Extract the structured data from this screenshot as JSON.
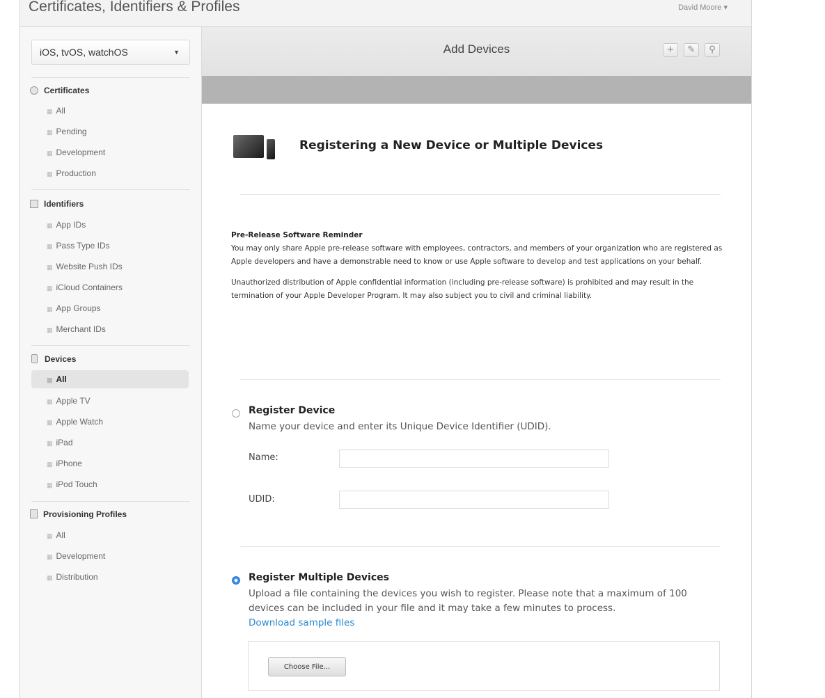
{
  "app": {
    "title": "Certificates, Identifiers & Profiles",
    "user_menu": "David Moore ▾"
  },
  "sidebar": {
    "platform_select": {
      "value": "iOS, tvOS, watchOS",
      "caret": "▼"
    },
    "bullet": "▦",
    "sections": {
      "certificates": {
        "label": "Certificates",
        "icon": "certificate-icon",
        "items": [
          "All",
          "Pending",
          "Development",
          "Production"
        ]
      },
      "identifiers": {
        "label": "Identifiers",
        "icon": "id-card-icon",
        "items": [
          "App IDs",
          "Pass Type IDs",
          "Website Push IDs",
          "iCloud Containers",
          "App Groups",
          "Merchant IDs"
        ]
      },
      "devices": {
        "label": "Devices",
        "icon": "phone-icon",
        "items": [
          "All",
          "Apple TV",
          "Apple Watch",
          "iPad",
          "iPhone",
          "iPod Touch"
        ],
        "active_item": "All"
      },
      "profiles": {
        "label": "Provisioning Profiles",
        "icon": "document-icon",
        "items": [
          "All",
          "Development",
          "Distribution"
        ]
      }
    }
  },
  "main": {
    "title": "Add Devices",
    "header_buttons": {
      "add": "+",
      "edit": "✎",
      "search": "⚲"
    },
    "content_title": "Registering a New Device or Multiple Devices",
    "reminder": {
      "title": "Pre-Release Software Reminder",
      "para1": "You may only share Apple pre-release software with employees, contractors, and members of your organization who are registered as Apple developers and have a demonstrable need to know or use Apple software to develop and test applications on your behalf.",
      "para2": "Unauthorized distribution of Apple confidential information (including pre-release software) is prohibited and may result in the termination of your Apple Developer Program. It may also subject you to civil and criminal liability."
    },
    "register_device": {
      "title": "Register Device",
      "description": "Name your device and enter its Unique Device Identifier (UDID).",
      "name_label": "Name:",
      "name_value": "",
      "udid_label": "UDID:",
      "udid_value": "",
      "selected": false
    },
    "register_multiple": {
      "title": "Register Multiple Devices",
      "description": "Upload a file containing the devices you wish to register. Please note that a maximum of 100 devices can be included in your file and it may take a few minutes to process.",
      "download_link": "Download sample files",
      "choose_file_label": "Choose File...",
      "selected": true
    },
    "accent_color": "#2a8ad1"
  }
}
